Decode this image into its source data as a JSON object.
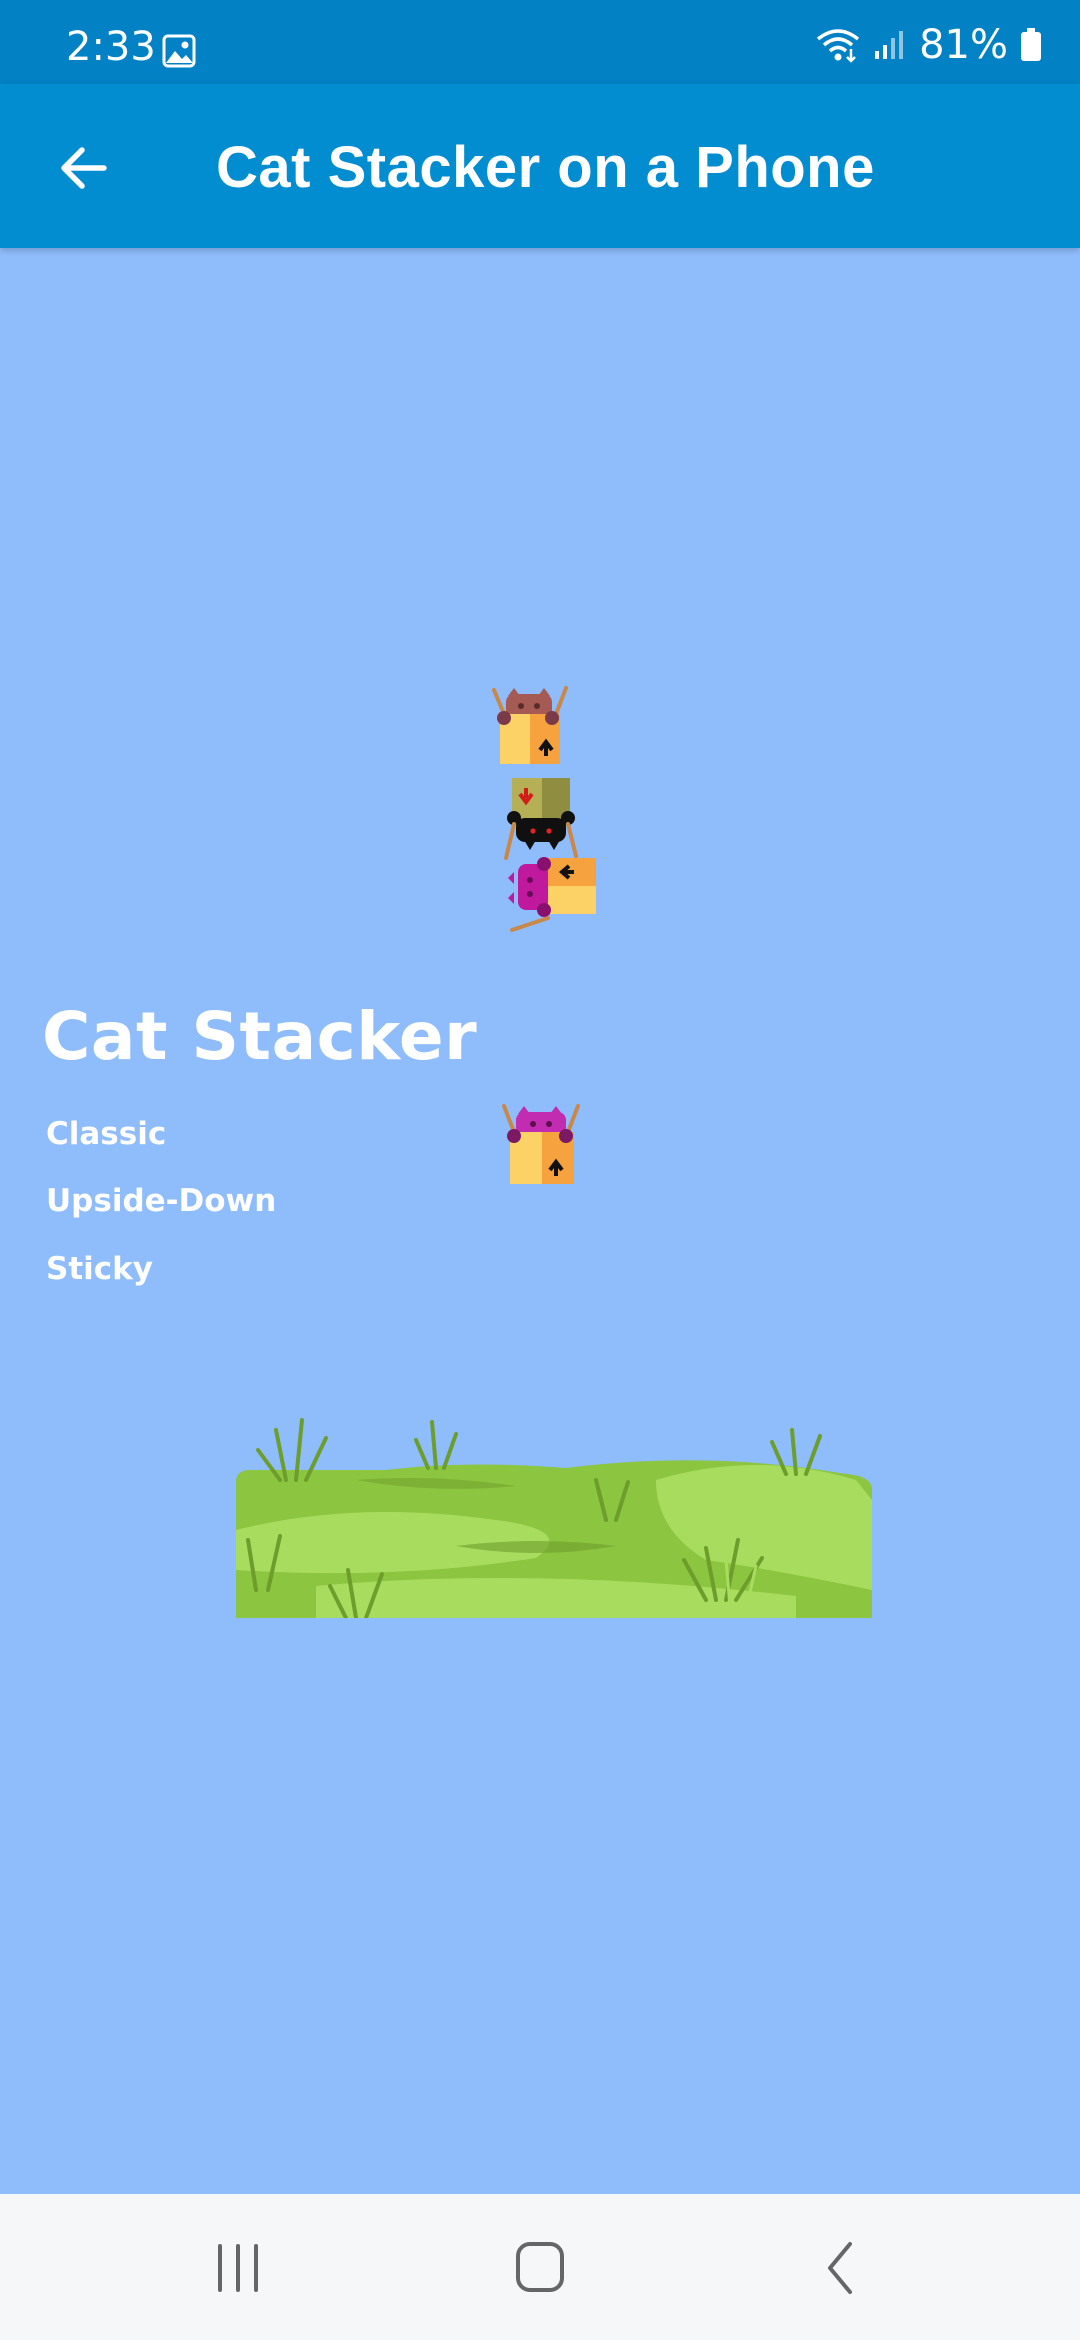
{
  "status_bar": {
    "time": "2:33",
    "battery": "81%",
    "icons": [
      "gallery-icon",
      "wifi-icon",
      "signal-icon",
      "battery-icon"
    ]
  },
  "app_bar": {
    "title": "Cat Stacker on a Phone",
    "back_icon": "arrow-left-icon"
  },
  "game": {
    "title": "Cat Stacker",
    "modes": [
      "Classic",
      "Upside-Down",
      "Sticky"
    ],
    "colors": {
      "sky": "#8fbdfc",
      "box": "#fcd266",
      "box_shade": "#f6a23e",
      "grass_light": "#a8dc5f",
      "grass_mid": "#8cc53f",
      "grass_dark": "#6d9d2c"
    },
    "cats": [
      {
        "name": "brown-cat",
        "color": "#a55a54"
      },
      {
        "name": "black-cat",
        "color": "#101010"
      },
      {
        "name": "magenta-cat",
        "color": "#c1199e"
      },
      {
        "name": "pink-cat",
        "color": "#c22cb0"
      }
    ]
  },
  "nav_bar": {
    "buttons": [
      "recent-apps-icon",
      "home-icon",
      "back-icon"
    ]
  }
}
